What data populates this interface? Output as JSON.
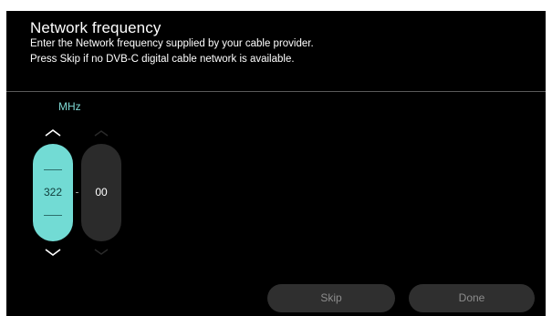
{
  "header": {
    "title": "Network frequency",
    "description_line1": "Enter the Network frequency supplied by your cable provider.",
    "description_line2": "Press Skip if no DVB-C digital cable network is available."
  },
  "frequency_input": {
    "unit": "MHz",
    "integer_value": "322",
    "decimal_value": "00",
    "active_field": "integer"
  },
  "icons": {
    "up": "chevron-up-icon",
    "down": "chevron-down-icon"
  },
  "buttons": {
    "skip_label": "Skip",
    "done_label": "Done"
  },
  "colors": {
    "accent": "#72dbd4",
    "background": "#000000",
    "button_bg": "#2f2f2f",
    "button_text": "#8c8c8c",
    "inactive_field": "#2b2b2b"
  }
}
